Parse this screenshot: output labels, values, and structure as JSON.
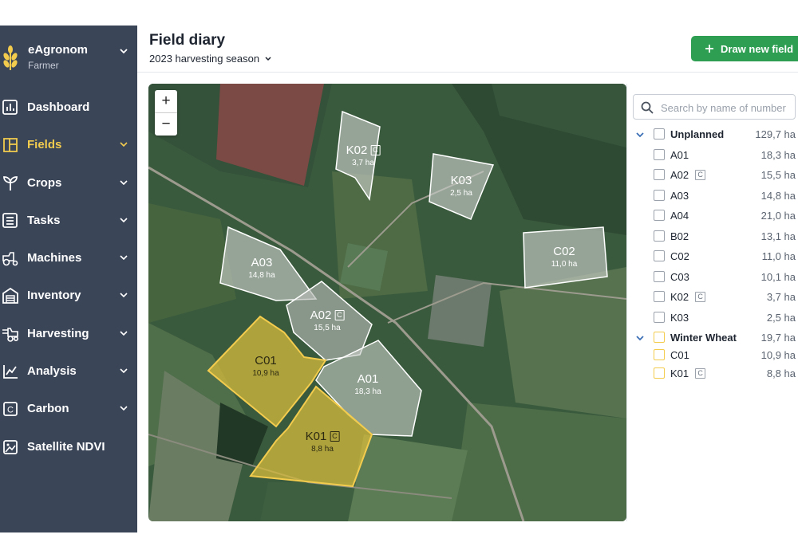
{
  "app": {
    "name": "eAgronom",
    "role": "Farmer"
  },
  "nav": [
    {
      "label": "Dashboard",
      "icon": "dashboard-icon",
      "active": false,
      "chevron": false
    },
    {
      "label": "Fields",
      "icon": "fields-icon",
      "active": true,
      "chevron": true
    },
    {
      "label": "Crops",
      "icon": "crops-icon",
      "active": false,
      "chevron": true
    },
    {
      "label": "Tasks",
      "icon": "tasks-icon",
      "active": false,
      "chevron": true
    },
    {
      "label": "Machines",
      "icon": "machines-icon",
      "active": false,
      "chevron": true
    },
    {
      "label": "Inventory",
      "icon": "inventory-icon",
      "active": false,
      "chevron": true
    },
    {
      "label": "Harvesting",
      "icon": "harvesting-icon",
      "active": false,
      "chevron": true
    },
    {
      "label": "Analysis",
      "icon": "analysis-icon",
      "active": false,
      "chevron": true
    },
    {
      "label": "Carbon",
      "icon": "carbon-icon",
      "active": false,
      "chevron": true
    },
    {
      "label": "Satellite NDVI",
      "icon": "satellite-icon",
      "active": false,
      "chevron": false
    }
  ],
  "header": {
    "title": "Field diary",
    "season": "2023 harvesting season",
    "draw_button": "Draw new field"
  },
  "map": {
    "zoom_in": "+",
    "zoom_out": "−",
    "fields": [
      {
        "name": "K02",
        "area": "3,7 ha",
        "badge": "C",
        "style": "grey"
      },
      {
        "name": "K03",
        "area": "2,5 ha",
        "badge": "",
        "style": "grey"
      },
      {
        "name": "C02",
        "area": "11,0 ha",
        "badge": "",
        "style": "grey"
      },
      {
        "name": "A03",
        "area": "14,8 ha",
        "badge": "",
        "style": "grey"
      },
      {
        "name": "A02",
        "area": "15,5 ha",
        "badge": "C",
        "style": "grey"
      },
      {
        "name": "C01",
        "area": "10,9 ha",
        "badge": "",
        "style": "yellow"
      },
      {
        "name": "A01",
        "area": "18,3 ha",
        "badge": "",
        "style": "grey"
      },
      {
        "name": "K01",
        "area": "8,8 ha",
        "badge": "C",
        "style": "yellow"
      }
    ]
  },
  "panel": {
    "search_placeholder": "Search by name of number",
    "groups": [
      {
        "label": "Unplanned",
        "total": "129,7 ha",
        "color": "#9aa1ab",
        "items": [
          {
            "name": "A01",
            "area": "18,3 ha",
            "badge": ""
          },
          {
            "name": "A02",
            "area": "15,5 ha",
            "badge": "C"
          },
          {
            "name": "A03",
            "area": "14,8 ha",
            "badge": ""
          },
          {
            "name": "A04",
            "area": "21,0 ha",
            "badge": ""
          },
          {
            "name": "B02",
            "area": "13,1 ha",
            "badge": ""
          },
          {
            "name": "C02",
            "area": "11,0 ha",
            "badge": ""
          },
          {
            "name": "C03",
            "area": "10,1 ha",
            "badge": ""
          },
          {
            "name": "K02",
            "area": "3,7 ha",
            "badge": "C"
          },
          {
            "name": "K03",
            "area": "2,5 ha",
            "badge": ""
          }
        ]
      },
      {
        "label": "Winter Wheat",
        "total": "19,7 ha",
        "color": "#f3cc4e",
        "items": [
          {
            "name": "C01",
            "area": "10,9 ha",
            "badge": ""
          },
          {
            "name": "K01",
            "area": "8,8 ha",
            "badge": "C"
          }
        ]
      }
    ]
  },
  "colors": {
    "sidebar": "#3b4558",
    "accent": "#f3cc4e",
    "primary_button": "#2e9e52"
  }
}
